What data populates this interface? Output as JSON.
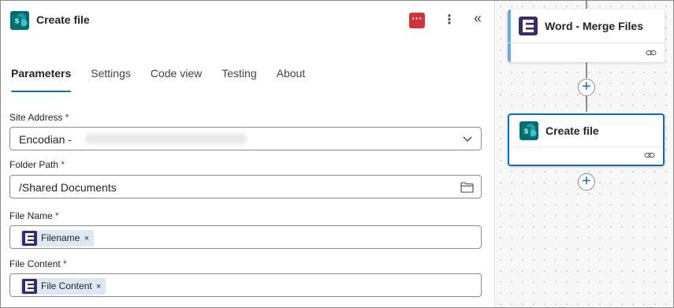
{
  "panel": {
    "title": "Create file",
    "app_icon": "sharepoint-icon",
    "badge_icon": "more-horizontal-red-icon",
    "badge_text": "···",
    "more_icon": "⋮",
    "collapse_icon": "«",
    "tabs": [
      {
        "label": "Parameters",
        "active": true
      },
      {
        "label": "Settings",
        "active": false
      },
      {
        "label": "Code view",
        "active": false
      },
      {
        "label": "Testing",
        "active": false
      },
      {
        "label": "About",
        "active": false
      }
    ]
  },
  "fields": {
    "site_address": {
      "label": "Site Address",
      "required_mark": "*",
      "value": "Encodian -"
    },
    "folder_path": {
      "label": "Folder Path",
      "required_mark": "*",
      "value": "/Shared Documents"
    },
    "file_name": {
      "label": "File Name",
      "required_mark": "*",
      "token": "Filename",
      "token_remove": "×"
    },
    "file_content": {
      "label": "File Content",
      "required_mark": "*",
      "token": "File Content",
      "token_remove": "×"
    }
  },
  "canvas": {
    "cards": [
      {
        "title": "Word - Merge Files",
        "icon": "encodian-icon"
      },
      {
        "title": "Create file",
        "icon": "sharepoint-icon",
        "selected": true
      }
    ],
    "plus": "+"
  },
  "colors": {
    "accent": "#0f6cbd",
    "required": "#c50f1f",
    "sharepoint": "#036c70",
    "encodian": "#3a2a6b",
    "badge": "#d13438"
  }
}
